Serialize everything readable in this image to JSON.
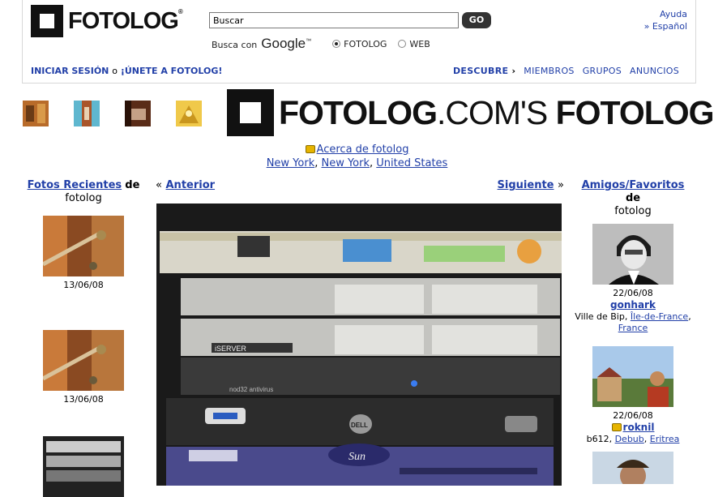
{
  "brand": {
    "logo_text": "FOTOLOG",
    "tm": "®"
  },
  "search": {
    "value": "Buscar",
    "go_label": "GO",
    "busca_con": "Busca con",
    "google": "Google",
    "google_tm": "™",
    "opt_fotolog": "FOTOLOG",
    "opt_web": "WEB"
  },
  "help": {
    "ayuda": "Ayuda",
    "idioma": "» Español"
  },
  "auth": {
    "login": "INICIAR SESIÓN",
    "o": "o",
    "join": "¡ÚNETE A FOTOLOG!"
  },
  "nav": {
    "discover": "DESCUBRE",
    "arrow": "›",
    "members": "MIEMBROS",
    "groups": "GRUPOS",
    "ads": "ANUNCIOS"
  },
  "banner": {
    "part1": "FOTOLOG",
    "part2": ".COM'S",
    "part3": "FOTOLOG"
  },
  "about": {
    "link": "Acerca de fotolog",
    "city": "New York",
    "state": "New York",
    "country": "United States"
  },
  "left": {
    "recent": "Fotos Recientes",
    "de": "de",
    "owner": "fotolog",
    "dates": [
      "13/06/08",
      "13/06/08"
    ]
  },
  "pager": {
    "prev_q": "«",
    "prev": "Anterior",
    "next": "Siguiente",
    "next_q": "»"
  },
  "right": {
    "title": "Amigos/Favoritos",
    "de": "de",
    "owner": "fotolog",
    "friends": [
      {
        "date": "22/06/08",
        "name": "gonhark",
        "place": "Ville de Bip,",
        "region": "Île-de-France",
        "country": "France"
      },
      {
        "date": "22/06/08",
        "name": "roknil",
        "place": "b612,",
        "region": "Debub",
        "country": "Eritrea"
      }
    ]
  },
  "photo_labels": {
    "iserver": "iSERVER",
    "antivirus": "nod32 antivirus",
    "sun": "Sun",
    "dell": "DELL"
  }
}
